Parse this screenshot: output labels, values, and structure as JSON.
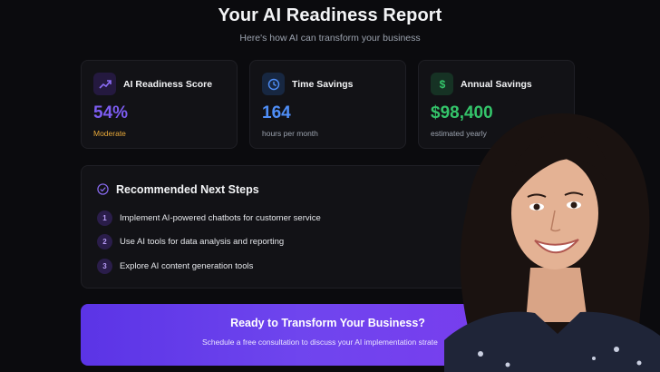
{
  "header": {
    "title": "Your AI Readiness Report",
    "subtitle": "Here's how AI can transform your business"
  },
  "cards": [
    {
      "title": "AI Readiness Score",
      "value": "54%",
      "caption": "Moderate",
      "icon": "trend-up-icon",
      "accent": "#7c5cf0",
      "caption_color": "#e8a93a"
    },
    {
      "title": "Time Savings",
      "value": "164",
      "caption": "hours per month",
      "icon": "clock-icon",
      "accent": "#4f8ef7",
      "caption_color": "#9ca3af"
    },
    {
      "title": "Annual Savings",
      "value": "$98,400",
      "caption": "estimated yearly",
      "icon": "dollar-icon",
      "accent": "#34c46a",
      "caption_color": "#9ca3af"
    }
  ],
  "steps": {
    "title": "Recommended Next Steps",
    "items": [
      {
        "num": "1",
        "text": "Implement AI-powered chatbots for customer service"
      },
      {
        "num": "2",
        "text": "Use AI tools for data analysis and reporting"
      },
      {
        "num": "3",
        "text": "Explore AI content generation tools"
      }
    ]
  },
  "cta": {
    "title": "Ready to Transform Your Business?",
    "subtitle": "Schedule a free consultation to discuss your AI implementation strate"
  }
}
